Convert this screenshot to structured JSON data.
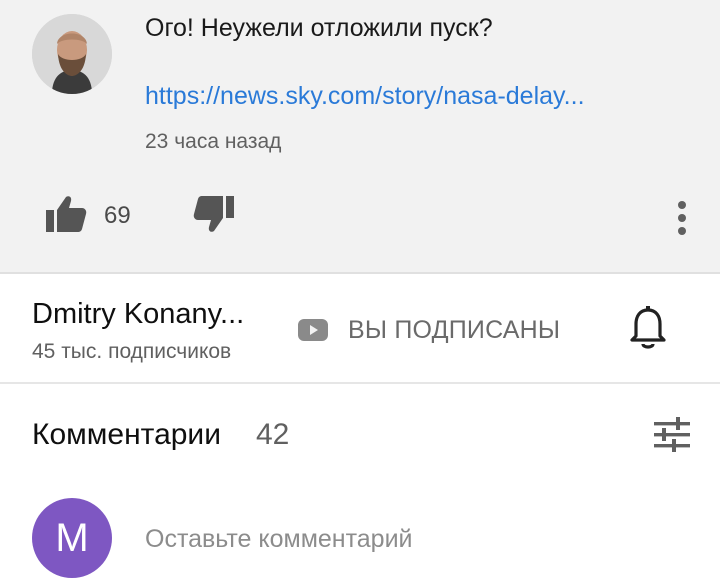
{
  "comment": {
    "text": "Ого! Неужели отложили пуск?",
    "link": "https://news.sky.com/story/nasa-delay...",
    "time": "23 часа назад",
    "likes": "69",
    "avatar_icon": "user-photo"
  },
  "channel": {
    "name": "Dmitry Konany...",
    "subscribers": "45 тыс. подписчиков",
    "subscribed_label": "ВЫ ПОДПИСАНЫ"
  },
  "comments": {
    "title": "Комментарии",
    "count": "42",
    "add_placeholder": "Оставьте комментарий",
    "user_initial": "M"
  },
  "colors": {
    "link": "#2a7ad8",
    "avatar_bg": "#7e57c2",
    "top_bg": "#f2f2f2"
  }
}
